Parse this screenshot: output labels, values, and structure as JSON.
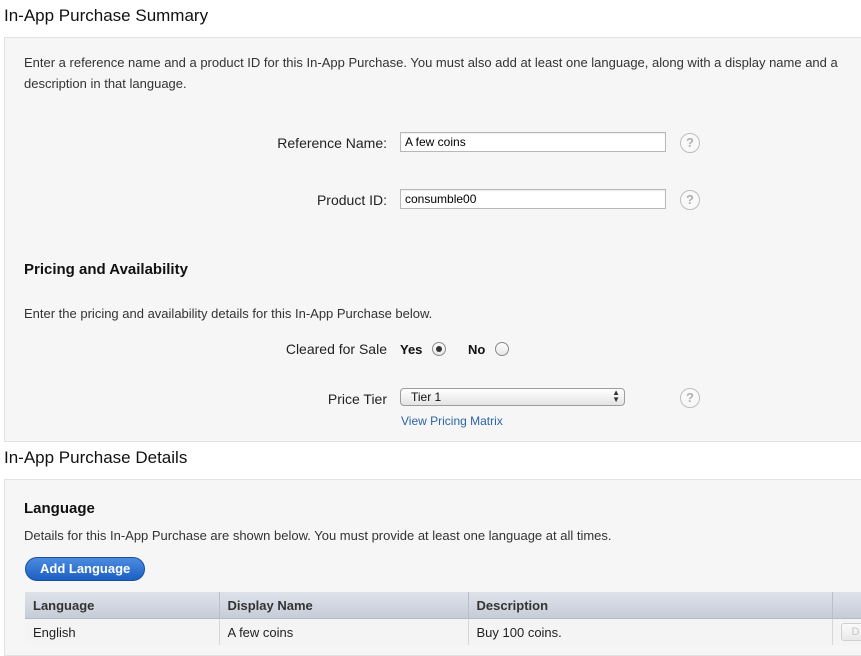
{
  "summary": {
    "title": "In-App Purchase Summary",
    "intro": "Enter a reference name and a product ID for this In-App Purchase. You must also add at least one language, along with a display name and a description in that language.",
    "reference_name_label": "Reference Name:",
    "reference_name_value": "A few coins",
    "product_id_label": "Product ID:",
    "product_id_value": "consumble00",
    "help_glyph": "?"
  },
  "pricing": {
    "title": "Pricing and Availability",
    "intro": "Enter the pricing and availability details for this In-App Purchase below.",
    "cleared_label": "Cleared for Sale",
    "yes_label": "Yes",
    "no_label": "No",
    "cleared_value": "Yes",
    "price_tier_label": "Price Tier",
    "price_tier_value": "Tier 1",
    "view_matrix_link": "View Pricing Matrix"
  },
  "details": {
    "title": "In-App Purchase Details",
    "language_heading": "Language",
    "intro": "Details for this In-App Purchase are shown below. You must provide at least one language at all times.",
    "add_language_button": "Add Language",
    "table": {
      "columns": [
        "Language",
        "Display Name",
        "Description",
        ""
      ],
      "rows": [
        {
          "language": "English",
          "display_name": "A few coins",
          "description": "Buy 100 coins.",
          "action": "D"
        }
      ]
    }
  },
  "colors": {
    "panel_bg": "#f6f6f6",
    "link": "#2a64a8",
    "button_blue": "#1d5fc3",
    "table_header": "#d3d8e1"
  }
}
